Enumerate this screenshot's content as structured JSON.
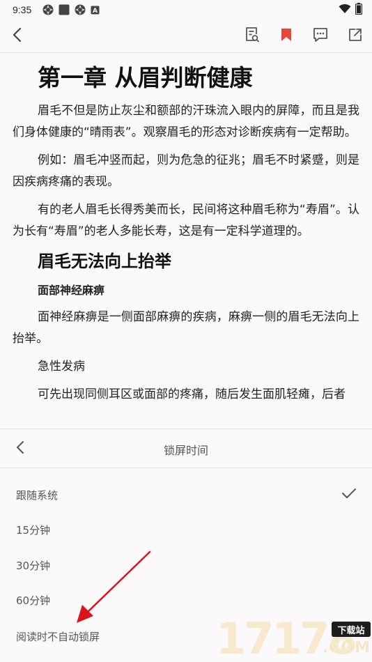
{
  "status_bar": {
    "time": "9:35",
    "left_icons": [
      "aperture-icon",
      "square-notification-icon",
      "aperture-icon",
      "a-box-icon"
    ],
    "right_icons": [
      "wifi-icon",
      "battery-icon"
    ]
  },
  "toolbar": {
    "icons": [
      "back-arrow-icon",
      "search-doc-icon",
      "bookmark-icon",
      "comment-icon",
      "share-icon"
    ],
    "bookmark_color": "#e8453c"
  },
  "article": {
    "chapter_title": "第一章 从眉判断健康",
    "paragraphs_1": [
      "眉毛不但是防止灰尘和额部的汗珠流入眼内的屏障，而且是我们身体健康的“晴雨表”。观察眉毛的形态对诊断疾病有一定帮助。",
      "例如：眉毛冲竖而起，则为危急的征兆；眉毛不时紧蹙，则是因疾病疼痛的表现。",
      "有的老人眉毛长得秀美而长，民间将这种眉毛称为“寿眉”。认为长有“寿眉”的老人多能长寿，这是有一定科学道理的。"
    ],
    "section_title": "眉毛无法向上抬举",
    "sub_heading": "面部神经麻痹",
    "paragraphs_2": [
      "面神经麻痹是一侧面部麻痹的疾病，麻痹一侧的眉毛无法向上抬举。",
      "急性发病",
      "可先出现同侧耳区或面部的疼痛，随后发生面肌轻瘫，后者"
    ]
  },
  "sheet": {
    "title": "锁屏时间",
    "options": [
      "跟随系统",
      "15分钟",
      "30分钟",
      "60分钟",
      "阅读时不自动锁屏"
    ],
    "selected_index": 0,
    "accent": "#d8141c"
  },
  "watermark": {
    "digits": "17178",
    "badge": "下载站",
    "suffix": ".COM"
  }
}
